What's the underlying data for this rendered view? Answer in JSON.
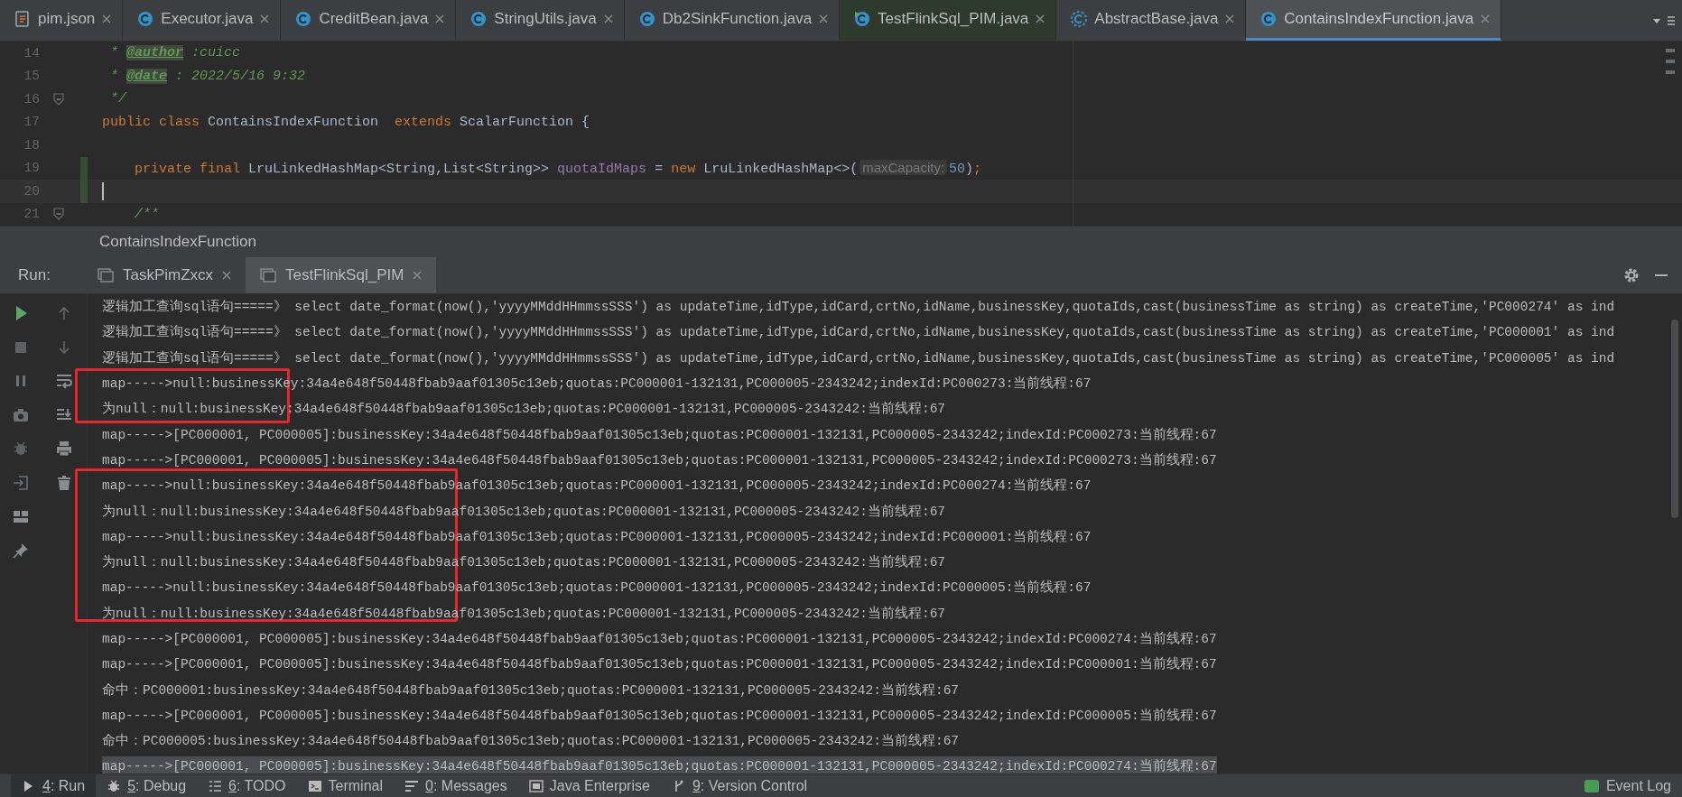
{
  "editor_tabs": [
    {
      "label": "pim.json",
      "kind": "json",
      "selected": false
    },
    {
      "label": "Executor.java",
      "kind": "class",
      "selected": false
    },
    {
      "label": "CreditBean.java",
      "kind": "class",
      "selected": false
    },
    {
      "label": "StringUtils.java",
      "kind": "class",
      "selected": false
    },
    {
      "label": "Db2SinkFunction.java",
      "kind": "class",
      "selected": false
    },
    {
      "label": "TestFlinkSql_PIM.java",
      "kind": "test",
      "selected": false
    },
    {
      "label": "AbstractBase.java",
      "kind": "abstract",
      "selected": false
    },
    {
      "label": "ContainsIndexFunction.java",
      "kind": "class",
      "selected": true
    }
  ],
  "editor": {
    "lines": [
      {
        "number": "14",
        "current": false,
        "changed": false,
        "fold": false,
        "tokens": [
          {
            "kind": "comment",
            "text": " * "
          },
          {
            "kind": "doctag",
            "text": "@author"
          },
          {
            "kind": "comment",
            "text": " :cuicc"
          }
        ]
      },
      {
        "number": "15",
        "current": false,
        "changed": false,
        "fold": false,
        "tokens": [
          {
            "kind": "comment",
            "text": " * "
          },
          {
            "kind": "doctag",
            "text": "@date"
          },
          {
            "kind": "comment",
            "text": " : 2022/5/16 9:32"
          }
        ]
      },
      {
        "number": "16",
        "current": false,
        "changed": false,
        "fold": true,
        "tokens": [
          {
            "kind": "comment",
            "text": " */"
          }
        ]
      },
      {
        "number": "17",
        "current": false,
        "changed": false,
        "fold": false,
        "tokens": [
          {
            "kind": "keyword",
            "text": "public class "
          },
          {
            "kind": "plain",
            "text": "ContainsIndexFunction  "
          },
          {
            "kind": "keyword",
            "text": "extends "
          },
          {
            "kind": "plain",
            "text": "ScalarFunction {"
          }
        ]
      },
      {
        "number": "18",
        "current": false,
        "changed": false,
        "fold": false
      },
      {
        "number": "19",
        "current": false,
        "changed": true,
        "fold": false,
        "tokens": [
          {
            "kind": "keyword",
            "text": "    private final "
          },
          {
            "kind": "plain",
            "text": "LruLinkedHashMap<String,List<String>> "
          },
          {
            "kind": "field",
            "text": "quotaIdMaps"
          },
          {
            "kind": "plain",
            "text": " = "
          },
          {
            "kind": "keyword",
            "text": "new "
          },
          {
            "kind": "plain",
            "text": "LruLinkedHashMap<>("
          },
          {
            "kind": "hint",
            "text": "maxCapacity:"
          },
          {
            "kind": "number",
            "text": "50"
          },
          {
            "kind": "plain",
            "text": ")"
          },
          {
            "kind": "keyword",
            "text": ";"
          }
        ]
      },
      {
        "number": "20",
        "current": true,
        "changed": true,
        "fold": false
      },
      {
        "number": "21",
        "current": false,
        "changed": false,
        "fold": true,
        "tokens": [
          {
            "kind": "comment",
            "text": "    /**"
          }
        ]
      }
    ]
  },
  "breadcrumb": "ContainsIndexFunction",
  "run_panel": {
    "label": "Run:",
    "tabs": [
      {
        "label": "TaskPimZxcx",
        "selected": false
      },
      {
        "label": "TestFlinkSql_PIM",
        "selected": true
      }
    ],
    "console": [
      {
        "text": "逻辑加工查询sql语句=====》 select date_format(now(),'yyyyMMddHHmmssSSS') as updateTime,idType,idCard,crtNo,idName,businessKey,quotaIds,cast(businessTime as string) as createTime,'PC000274' as ind",
        "highlighted": false
      },
      {
        "text": "逻辑加工查询sql语句=====》 select date_format(now(),'yyyyMMddHHmmssSSS') as updateTime,idType,idCard,crtNo,idName,businessKey,quotaIds,cast(businessTime as string) as createTime,'PC000001' as ind",
        "highlighted": false
      },
      {
        "text": "逻辑加工查询sql语句=====》 select date_format(now(),'yyyyMMddHHmmssSSS') as updateTime,idType,idCard,crtNo,idName,businessKey,quotaIds,cast(businessTime as string) as createTime,'PC000005' as ind",
        "highlighted": false
      },
      {
        "text": "map----->null:businessKey:34a4e648f50448fbab9aaf01305c13eb;quotas:PC000001-132131,PC000005-2343242;indexId:PC000273:当前线程:67",
        "highlighted": false
      },
      {
        "text": "为null：null:businessKey:34a4e648f50448fbab9aaf01305c13eb;quotas:PC000001-132131,PC000005-2343242:当前线程:67",
        "highlighted": false
      },
      {
        "text": "map----->[PC000001, PC000005]:businessKey:34a4e648f50448fbab9aaf01305c13eb;quotas:PC000001-132131,PC000005-2343242;indexId:PC000273:当前线程:67",
        "highlighted": false
      },
      {
        "text": "map----->[PC000001, PC000005]:businessKey:34a4e648f50448fbab9aaf01305c13eb;quotas:PC000001-132131,PC000005-2343242;indexId:PC000273:当前线程:67",
        "highlighted": false
      },
      {
        "text": "map----->null:businessKey:34a4e648f50448fbab9aaf01305c13eb;quotas:PC000001-132131,PC000005-2343242;indexId:PC000274:当前线程:67",
        "highlighted": false
      },
      {
        "text": "为null：null:businessKey:34a4e648f50448fbab9aaf01305c13eb;quotas:PC000001-132131,PC000005-2343242:当前线程:67",
        "highlighted": false
      },
      {
        "text": "map----->null:businessKey:34a4e648f50448fbab9aaf01305c13eb;quotas:PC000001-132131,PC000005-2343242;indexId:PC000001:当前线程:67",
        "highlighted": false
      },
      {
        "text": "为null：null:businessKey:34a4e648f50448fbab9aaf01305c13eb;quotas:PC000001-132131,PC000005-2343242:当前线程:67",
        "highlighted": false
      },
      {
        "text": "map----->null:businessKey:34a4e648f50448fbab9aaf01305c13eb;quotas:PC000001-132131,PC000005-2343242;indexId:PC000005:当前线程:67",
        "highlighted": false
      },
      {
        "text": "为null：null:businessKey:34a4e648f50448fbab9aaf01305c13eb;quotas:PC000001-132131,PC000005-2343242:当前线程:67",
        "highlighted": false
      },
      {
        "text": "map----->[PC000001, PC000005]:businessKey:34a4e648f50448fbab9aaf01305c13eb;quotas:PC000001-132131,PC000005-2343242;indexId:PC000274:当前线程:67",
        "highlighted": false
      },
      {
        "text": "map----->[PC000001, PC000005]:businessKey:34a4e648f50448fbab9aaf01305c13eb;quotas:PC000001-132131,PC000005-2343242;indexId:PC000001:当前线程:67",
        "highlighted": false
      },
      {
        "text": "命中：PC000001:businessKey:34a4e648f50448fbab9aaf01305c13eb;quotas:PC000001-132131,PC000005-2343242:当前线程:67",
        "highlighted": false
      },
      {
        "text": "map----->[PC000001, PC000005]:businessKey:34a4e648f50448fbab9aaf01305c13eb;quotas:PC000001-132131,PC000005-2343242;indexId:PC000005:当前线程:67",
        "highlighted": false
      },
      {
        "text": "命中：PC000005:businessKey:34a4e648f50448fbab9aaf01305c13eb;quotas:PC000001-132131,PC000005-2343242:当前线程:67",
        "highlighted": false
      },
      {
        "text": "map----->[PC000001, PC000005]:businessKey:34a4e648f50448fbab9aaf01305c13eb;quotas:PC000001-132131,PC000005-2343242;indexId:PC000274:当前线程:67",
        "highlighted": true
      }
    ]
  },
  "status_bar": {
    "items": [
      {
        "kind": "run",
        "key": "4",
        "label": ": Run",
        "selected": true
      },
      {
        "kind": "debug",
        "key": "5",
        "label": ": Debug",
        "selected": false
      },
      {
        "kind": "todo",
        "key": "6",
        "label": ": TODO",
        "selected": false
      },
      {
        "kind": "terminal",
        "label": "Terminal",
        "selected": false
      },
      {
        "kind": "messages",
        "key": "0",
        "label": ": Messages",
        "selected": false
      },
      {
        "kind": "enterprise",
        "label": "Java Enterprise",
        "selected": false
      },
      {
        "kind": "vcs",
        "key": "9",
        "label": ": Version Control",
        "selected": false
      }
    ],
    "event_log": "Event Log"
  }
}
